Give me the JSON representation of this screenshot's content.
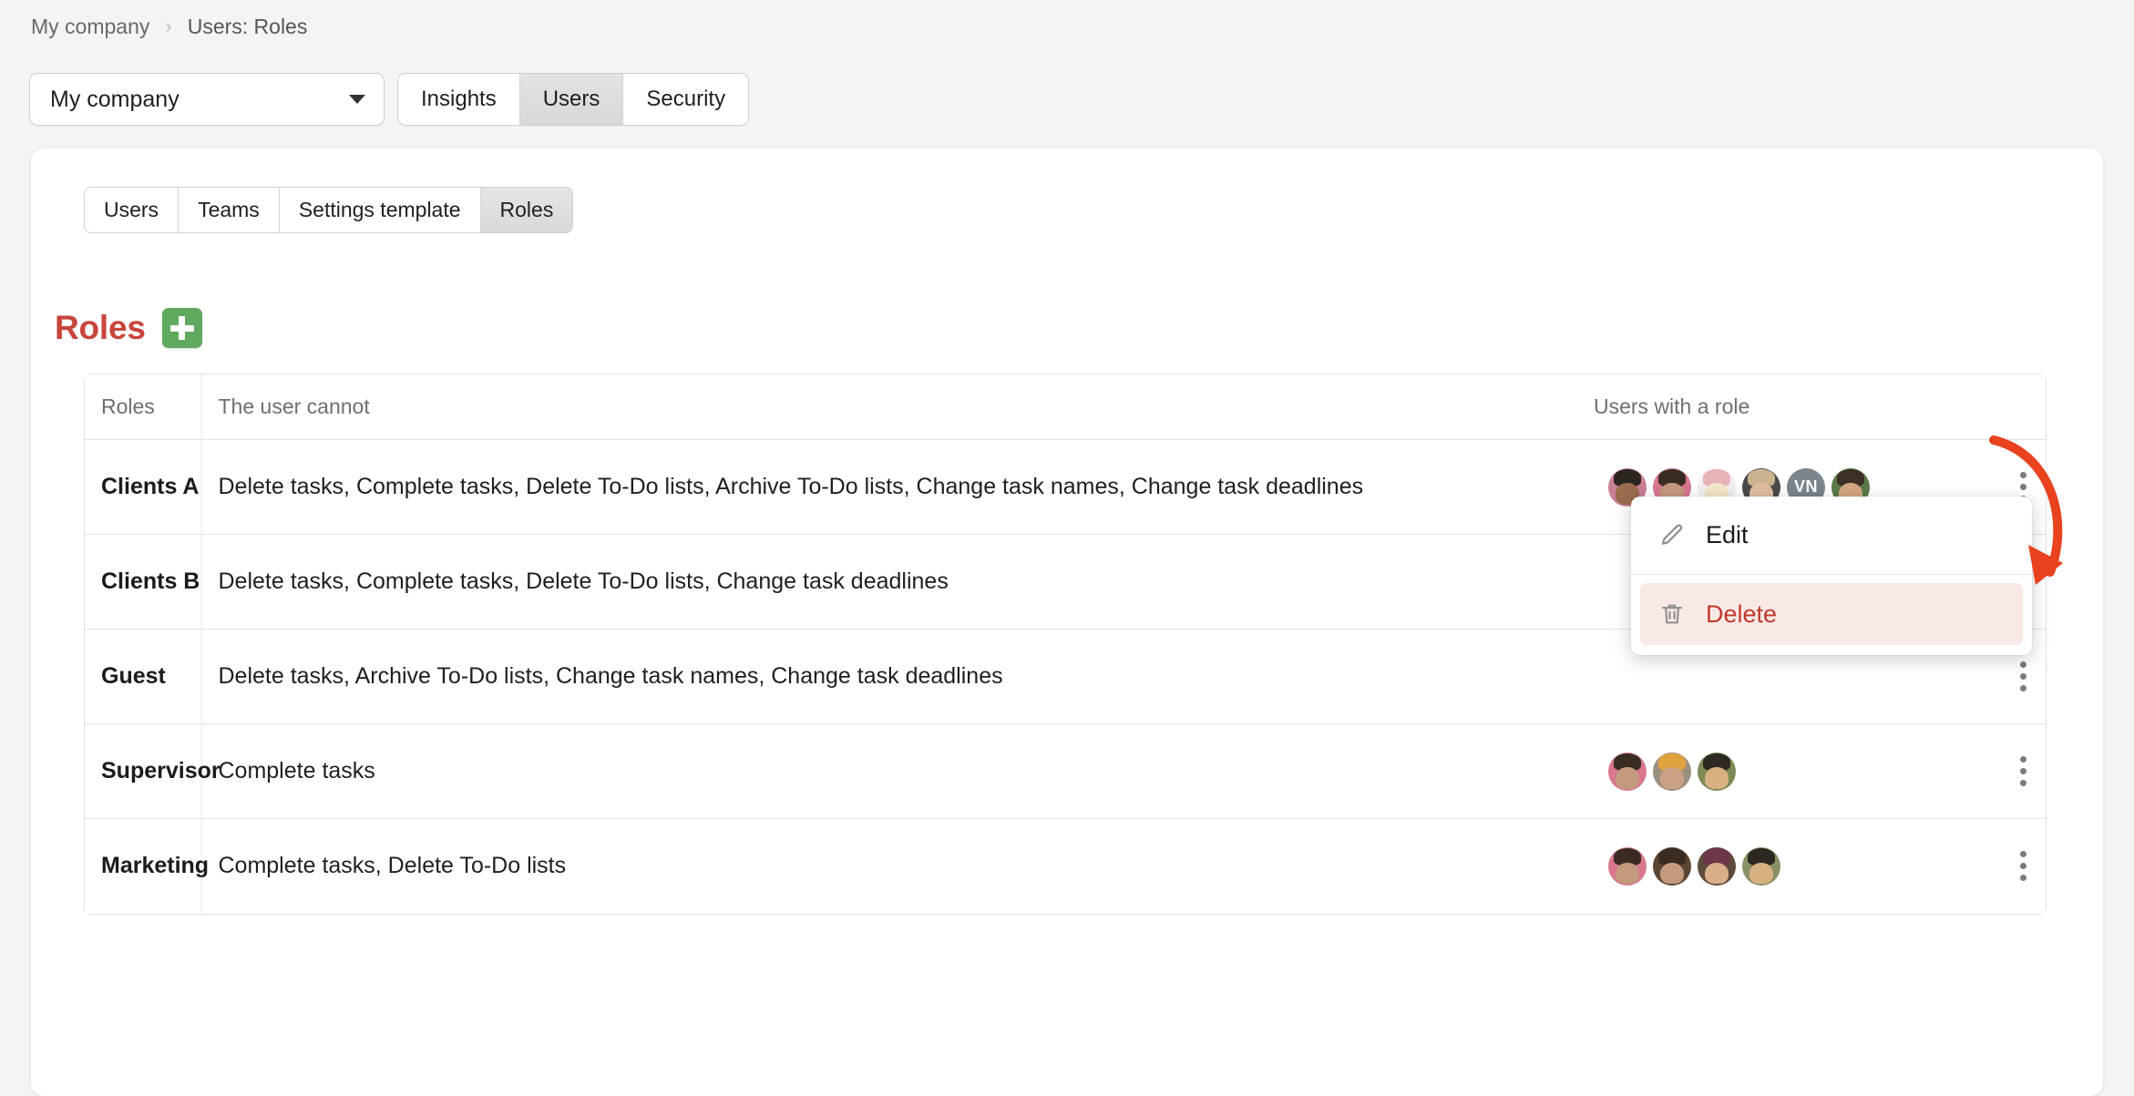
{
  "breadcrumb": {
    "items": [
      "My company",
      "Users: Roles"
    ],
    "separator": "›"
  },
  "topbar": {
    "company_select": {
      "value": "My company",
      "icon": "chevron-down-icon"
    },
    "segments": [
      {
        "label": "Insights",
        "active": false
      },
      {
        "label": "Users",
        "active": true
      },
      {
        "label": "Security",
        "active": false
      }
    ]
  },
  "subtabs": [
    {
      "label": "Users",
      "active": false
    },
    {
      "label": "Teams",
      "active": false
    },
    {
      "label": "Settings template",
      "active": false
    },
    {
      "label": "Roles",
      "active": true
    }
  ],
  "section": {
    "title": "Roles",
    "add_button_icon": "plus-icon",
    "title_color": "#c8453c",
    "add_button_color": "#5faa5f"
  },
  "table": {
    "headers": [
      "Roles",
      "The user cannot",
      "Users with a role"
    ],
    "rows": [
      {
        "role": "Clients A",
        "cannot": "Delete tasks, Complete tasks, Delete To-Do lists, Archive To-Do lists, Change task names, Change task deadlines",
        "users": [
          {
            "type": "photo",
            "bg": "#c97f93",
            "hair": "#2b2520",
            "skin": "#9a6c4e"
          },
          {
            "type": "photo",
            "bg": "#d8778f",
            "hair": "#3a2c22",
            "skin": "#c49a7e"
          },
          {
            "type": "photo",
            "bg": "#f2f0ee",
            "hair": "#e8b3b8",
            "skin": "#f3e6c9"
          },
          {
            "type": "photo",
            "bg": "#4a4a4a",
            "hair": "#c9b48e",
            "skin": "#dfbda2"
          },
          {
            "type": "initials",
            "initials": "VN",
            "bg": "#7c858c"
          },
          {
            "type": "photo",
            "bg": "#5c7a4a",
            "hair": "#3b2f26",
            "skin": "#d3a781"
          }
        ]
      },
      {
        "role": "Clients B",
        "cannot": "Delete tasks, Complete tasks, Delete To-Do lists, Change task deadlines",
        "users": []
      },
      {
        "role": "Guest",
        "cannot": "Delete tasks, Archive To-Do lists, Change task names, Change task deadlines",
        "users": []
      },
      {
        "role": "Supervisor",
        "cannot": "Complete tasks",
        "users": [
          {
            "type": "photo",
            "bg": "#d8778f",
            "hair": "#3a2c22",
            "skin": "#c49a7e"
          },
          {
            "type": "photo",
            "bg": "#9c8f7e",
            "hair": "#e0a23c",
            "skin": "#caa184"
          },
          {
            "type": "photo",
            "bg": "#7b8a55",
            "hair": "#2e2822",
            "skin": "#d8b183"
          }
        ]
      },
      {
        "role": "Marketing",
        "cannot": "Complete tasks, Delete To-Do lists",
        "users": [
          {
            "type": "photo",
            "bg": "#d8778f",
            "hair": "#3a2c22",
            "skin": "#c49a7e"
          },
          {
            "type": "photo",
            "bg": "#5c4632",
            "hair": "#3a2c22",
            "skin": "#c49a7e"
          },
          {
            "type": "photo",
            "bg": "#5c4a3a",
            "hair": "#6d3747",
            "skin": "#d9ae8a"
          },
          {
            "type": "photo",
            "bg": "#8a9166",
            "hair": "#2e2822",
            "skin": "#d8b183"
          }
        ]
      }
    ],
    "row_menu_icon": "kebab-menu-icon"
  },
  "dropdown": {
    "items": [
      {
        "label": "Edit",
        "icon": "pencil-icon",
        "danger": false
      },
      {
        "label": "Delete",
        "icon": "trash-icon",
        "danger": true
      }
    ],
    "danger_color": "#c0392b",
    "danger_bg": "#f8e9e7"
  },
  "annotation": {
    "arrow_color": "#e8421f",
    "name": "red-callout-arrow"
  }
}
